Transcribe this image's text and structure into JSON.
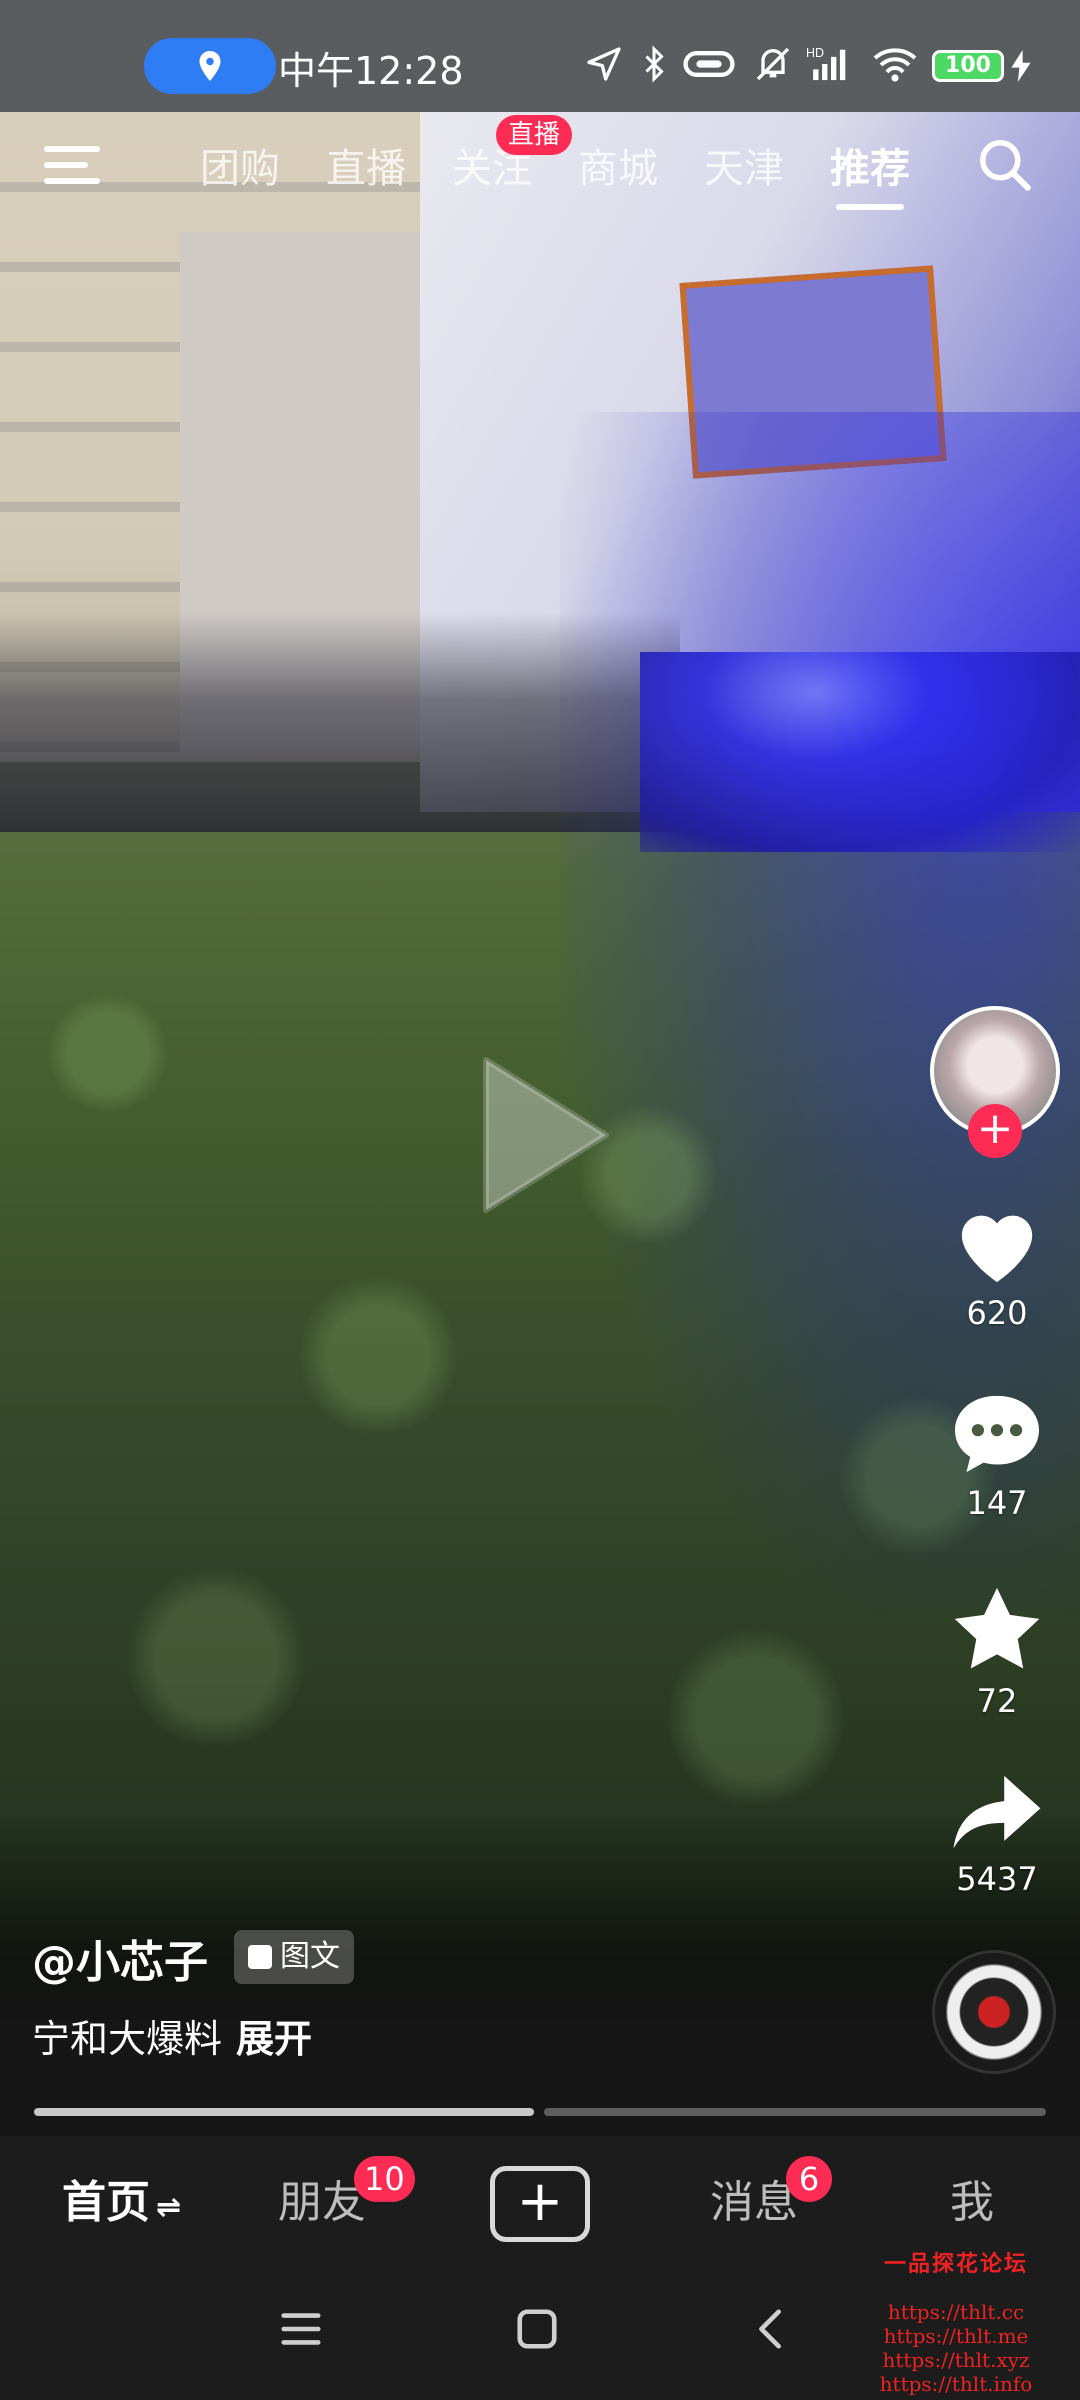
{
  "status_bar": {
    "time": "中午12:28",
    "battery": "100"
  },
  "top_nav": {
    "tabs": [
      "团购",
      "直播",
      "关注",
      "商城",
      "天津",
      "推荐"
    ],
    "active_tab": "推荐",
    "live_badge": "直播"
  },
  "rail": {
    "likes": "620",
    "comments": "147",
    "favorites": "72",
    "shares": "5437"
  },
  "post": {
    "author": "@小芯子",
    "type_badge": "图文",
    "caption": "宁和大爆料",
    "expand": "展开"
  },
  "bottom_tabs": {
    "home": "首页",
    "friends": "朋友",
    "friends_badge": "10",
    "messages": "消息",
    "messages_badge": "6",
    "me": "我"
  },
  "watermark": {
    "title": "一品探花论坛",
    "urls": [
      "https://thlt.cc",
      "https://thlt.me",
      "https://thlt.xyz",
      "https://thlt.info"
    ]
  },
  "colors": {
    "accent": "#fe2c55",
    "location_pill": "#2f7df5",
    "battery": "#4cd964"
  }
}
